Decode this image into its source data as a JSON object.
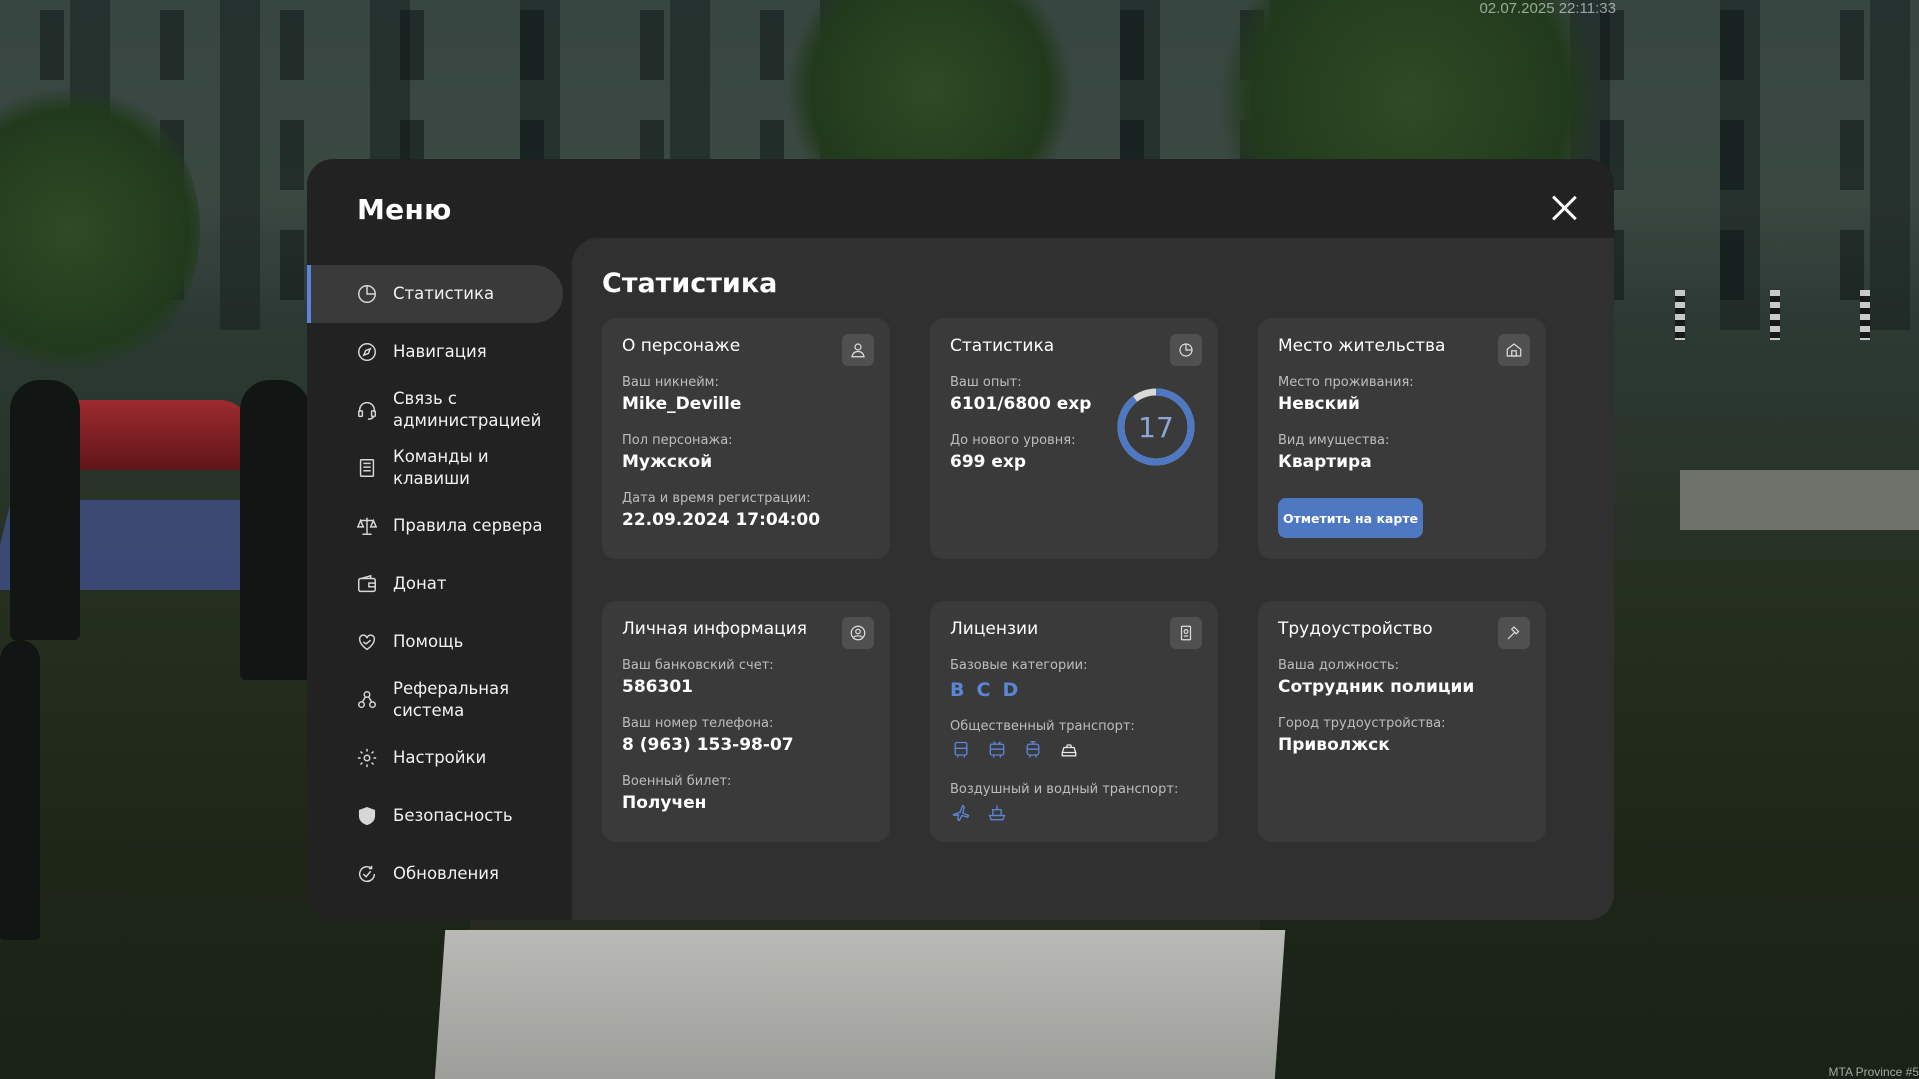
{
  "hud": {
    "timestamp": "02.07.2025 22:11:33",
    "server": "MTA Province #5"
  },
  "menu": {
    "title": "Меню",
    "close_icon": "close-icon",
    "active_item": "Статистика"
  },
  "sidebar": {
    "items": [
      {
        "label": "Статистика",
        "icon": "pie-chart-icon"
      },
      {
        "label": "Навигация",
        "icon": "compass-icon"
      },
      {
        "label": "Связь с\nадминистрацией",
        "icon": "headset-icon"
      },
      {
        "label": "Команды и\nклавиши",
        "icon": "document-list-icon"
      },
      {
        "label": "Правила сервера",
        "icon": "scales-icon"
      },
      {
        "label": "Донат",
        "icon": "wallet-icon"
      },
      {
        "label": "Помощь",
        "icon": "heart-hands-icon"
      },
      {
        "label": "Реферальная\nсистема",
        "icon": "referral-network-icon"
      },
      {
        "label": "Настройки",
        "icon": "gear-icon"
      },
      {
        "label": "Безопасность",
        "icon": "shield-icon"
      },
      {
        "label": "Обновления",
        "icon": "refresh-check-icon"
      }
    ]
  },
  "content": {
    "title": "Статистика"
  },
  "cards": {
    "character": {
      "title": "О персонаже",
      "icon": "user-icon",
      "nickname_label": "Ваш никнейм:",
      "nickname": "Mike_Deville",
      "gender_label": "Пол персонажа:",
      "gender": "Мужской",
      "reg_label": "Дата и время регистрации:",
      "reg_date": "22.09.2024 17:04:00"
    },
    "stats": {
      "title": "Статистика",
      "icon": "pie-chart-icon",
      "exp_label": "Ваш опыт:",
      "exp": "6101/6800 exp",
      "next_label": "До нового уровня:",
      "next": "699 exp",
      "level": "17",
      "level_progress": 0.897
    },
    "residence": {
      "title": "Место жительства",
      "icon": "home-icon",
      "place_label": "Место проживания:",
      "place": "Невский",
      "property_label": "Вид имущества:",
      "property": "Квартира",
      "map_button": "Отметить на карте"
    },
    "personal": {
      "title": "Личная информация",
      "icon": "user-circle-icon",
      "bank_label": "Ваш банковский счет:",
      "bank": "586301",
      "phone_label": "Ваш номер телефона:",
      "phone": "8 (963) 153-98-07",
      "military_label": "Военный билет:",
      "military": "Получен"
    },
    "licenses": {
      "title": "Лицензии",
      "icon": "id-badge-icon",
      "base_label": "Базовые категории:",
      "categories": [
        "B",
        "C",
        "D"
      ],
      "public_label": "Общественный транспорт:",
      "public_icons": [
        "bus-icon",
        "trolleybus-icon",
        "tram-icon",
        "taxi-icon"
      ],
      "air_label": "Воздушный и водный транспорт:",
      "air_icons": [
        "plane-icon",
        "boat-icon"
      ],
      "accent": "#5b86d6"
    },
    "employment": {
      "title": "Трудоустройство",
      "icon": "hammer-icon",
      "position_label": "Ваша должность:",
      "position": "Сотрудник полиции",
      "city_label": "Город трудоустройства:",
      "city": "Приволжск"
    }
  },
  "colors": {
    "accent": "#5b86d6",
    "panel": "#222222",
    "content": "#303030",
    "card": "#3a3a3a"
  }
}
